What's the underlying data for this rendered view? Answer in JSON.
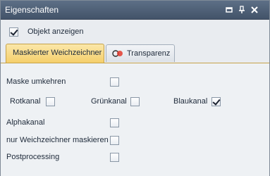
{
  "window": {
    "title": "Eigenschaften"
  },
  "titlebar_buttons": [
    {
      "name": "restore-icon"
    },
    {
      "name": "pin-icon"
    },
    {
      "name": "close-icon"
    }
  ],
  "show_object": {
    "label": "Objekt anzeigen",
    "checked": true
  },
  "tabs": [
    {
      "label": "Maskierter Weichzeichner",
      "active": true
    },
    {
      "label": "Transparenz",
      "active": false,
      "icon": "transparency-icon"
    }
  ],
  "options": {
    "mask_invert": {
      "label": "Maske umkehren",
      "checked": false
    },
    "red": {
      "label": "Rotkanal",
      "checked": false
    },
    "green": {
      "label": "Grünkanal",
      "checked": false
    },
    "blue": {
      "label": "Blaukanal",
      "checked": true
    },
    "alpha": {
      "label": "Alphakanal",
      "checked": false
    },
    "blur_only": {
      "label": "nur Weichzeichner maskieren",
      "checked": false
    },
    "post": {
      "label": "Postprocessing",
      "checked": false
    }
  },
  "colors": {
    "titlebar": "#4e5f77",
    "active_tab": "#f7d678",
    "panel_bg": "#eef1f4"
  }
}
